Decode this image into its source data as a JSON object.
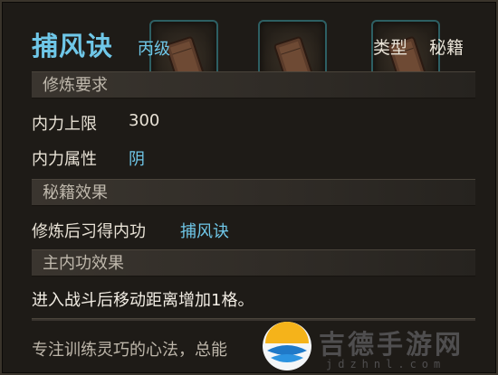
{
  "item": {
    "name": "捕风诀",
    "grade": "丙级",
    "type_label": "类型",
    "type_value": "秘籍"
  },
  "sections": {
    "requirements": "修炼要求",
    "effects": "秘籍效果",
    "main_effect": "主内功效果"
  },
  "requirements": {
    "max_internal_label": "内力上限",
    "max_internal_value": "300",
    "attribute_label": "内力属性",
    "attribute_value": "阴"
  },
  "effects": {
    "learn_label": "修炼后习得内功",
    "learn_value": "捕风诀"
  },
  "main_effect_text": "进入战斗后移动距离增加1格。",
  "flavor_text": "专注训练灵巧的心法，总能",
  "watermark": {
    "text": "吉德手游网",
    "sub": "jdzhnl.com"
  },
  "colors": {
    "accent_blue": "#6fc7e8",
    "text_light": "#e8e2d6",
    "panel_bg": "#1e1b17"
  }
}
